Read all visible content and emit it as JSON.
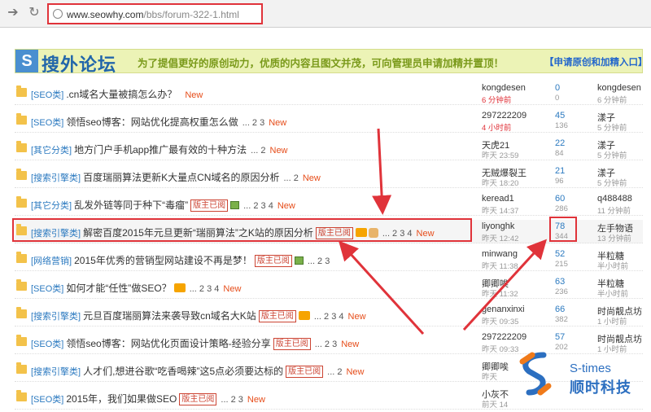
{
  "browser": {
    "url_domain": "www.seowhy.com",
    "url_path": "/bbs/forum-322-1.html"
  },
  "banner": {
    "logo_letter": "S",
    "logo_text": "搜外论坛",
    "slogan": "为了提倡更好的原创动力，优质的内容且图文并茂，可向管理员申请加精并置顶！",
    "apply_link": "【申请原创和加精入口】"
  },
  "threads": [
    {
      "category": "[SEO类]",
      "title": ".cn域名大量被搞怎么办？",
      "badges": [],
      "pages": "",
      "new_label": "New",
      "author": "kongdesen",
      "author_date": "6 分钟前",
      "author_date_red": true,
      "replies": "0",
      "views": "0",
      "last_user": "kongdesen",
      "last_time": "6 分钟前"
    },
    {
      "category": "[SEO类]",
      "title": "领悟seo博客：网站优化提高权重怎么做",
      "badges": [],
      "pages": "... 2 3",
      "new_label": "New",
      "author": "297222209",
      "author_date": "4 小时前",
      "author_date_red": true,
      "replies": "45",
      "views": "136",
      "last_user": "漾子",
      "last_time": "5 分钟前"
    },
    {
      "category": "[其它分类]",
      "title": "地方门户手机app推广最有效的十种方法",
      "badges": [],
      "pages": "... 2",
      "new_label": "New",
      "author": "天虎21",
      "author_date": "昨天 23:59",
      "author_date_red": false,
      "replies": "22",
      "views": "84",
      "last_user": "漾子",
      "last_time": "5 分钟前"
    },
    {
      "category": "[搜索引擎类]",
      "title": "百度瑞丽算法更新K大量点CN域名的原因分析",
      "badges": [],
      "pages": "... 2",
      "new_label": "New",
      "author": "无贼爆裂王",
      "author_date": "昨天 18:20",
      "author_date_red": false,
      "replies": "21",
      "views": "96",
      "last_user": "漾子",
      "last_time": "5 分钟前"
    },
    {
      "category": "[其它分类]",
      "title": "乱发外链等同于种下“毒瘤”",
      "badges": [
        "版主已阅",
        "img"
      ],
      "pages": "... 2 3 4",
      "new_label": "New",
      "author": "keread1",
      "author_date": "昨天 14:37",
      "author_date_red": false,
      "replies": "60",
      "views": "286",
      "last_user": "q488488",
      "last_time": "11 分钟前"
    },
    {
      "category": "[搜索引擎类]",
      "title": "解密百度2015年元旦更新“瑞丽算法”之K站的原因分析",
      "badges": [
        "版主已阅",
        "hot",
        "thumb"
      ],
      "pages": "... 2 3 4",
      "new_label": "New",
      "author": "liyonghk",
      "author_date": "昨天 12:42",
      "author_date_red": false,
      "replies": "78",
      "views": "344",
      "last_user": "左手物语",
      "last_time": "13 分钟前"
    },
    {
      "category": "[网络营销]",
      "title": "2015年优秀的营销型网站建设不再是梦！",
      "badges": [
        "版主已阅",
        "img"
      ],
      "pages": "... 2 3",
      "new_label": "",
      "author": "minwang",
      "author_date": "昨天 11:38",
      "author_date_red": false,
      "replies": "52",
      "views": "215",
      "last_user": "半粒糖",
      "last_time": "半小时前"
    },
    {
      "category": "[SEO类]",
      "title": "如何才能“任性”做SEO？",
      "badges": [
        "hot"
      ],
      "pages": "... 2 3 4",
      "new_label": "New",
      "author": "卿卿唉",
      "author_date": "昨天 11:32",
      "author_date_red": false,
      "replies": "63",
      "views": "236",
      "last_user": "半粒糖",
      "last_time": "半小时前"
    },
    {
      "category": "[搜索引擎类]",
      "title": "元旦百度瑞丽算法来袭导致cn域名大K站",
      "badges": [
        "版主已阅",
        "hot"
      ],
      "pages": "... 2 3 4",
      "new_label": "New",
      "author": "genanxinxi",
      "author_date": "昨天 09:35",
      "author_date_red": false,
      "replies": "66",
      "views": "382",
      "last_user": "时尚靓点坊",
      "last_time": "1 小时前"
    },
    {
      "category": "[SEO类]",
      "title": "领悟seo博客：网站优化页面设计策略-经验分享",
      "badges": [
        "版主已阅"
      ],
      "pages": "... 2 3",
      "new_label": "New",
      "author": "297222209",
      "author_date": "昨天 09:33",
      "author_date_red": false,
      "replies": "57",
      "views": "202",
      "last_user": "时尚靓点坊",
      "last_time": "1 小时前"
    },
    {
      "category": "[搜索引擎类]",
      "title": "人才们,想进谷歌“吃香喝辣”这5点必须要达标的",
      "badges": [
        "版主已阅"
      ],
      "pages": "... 2",
      "new_label": "New",
      "author": "卿卿唉",
      "author_date": "昨天",
      "author_date_red": false,
      "replies": "",
      "views": "",
      "last_user": "",
      "last_time": ""
    },
    {
      "category": "[SEO类]",
      "title": "2015年，我们如果做SEO",
      "badges": [
        "版主已阅"
      ],
      "pages": "... 2 3",
      "new_label": "New",
      "author": "小灰不",
      "author_date": "前天 14",
      "author_date_red": false,
      "replies": "",
      "views": "",
      "last_user": "",
      "last_time": ""
    }
  ],
  "watermark": {
    "brand_en": "S-times",
    "brand_cn": "顺时科技"
  }
}
